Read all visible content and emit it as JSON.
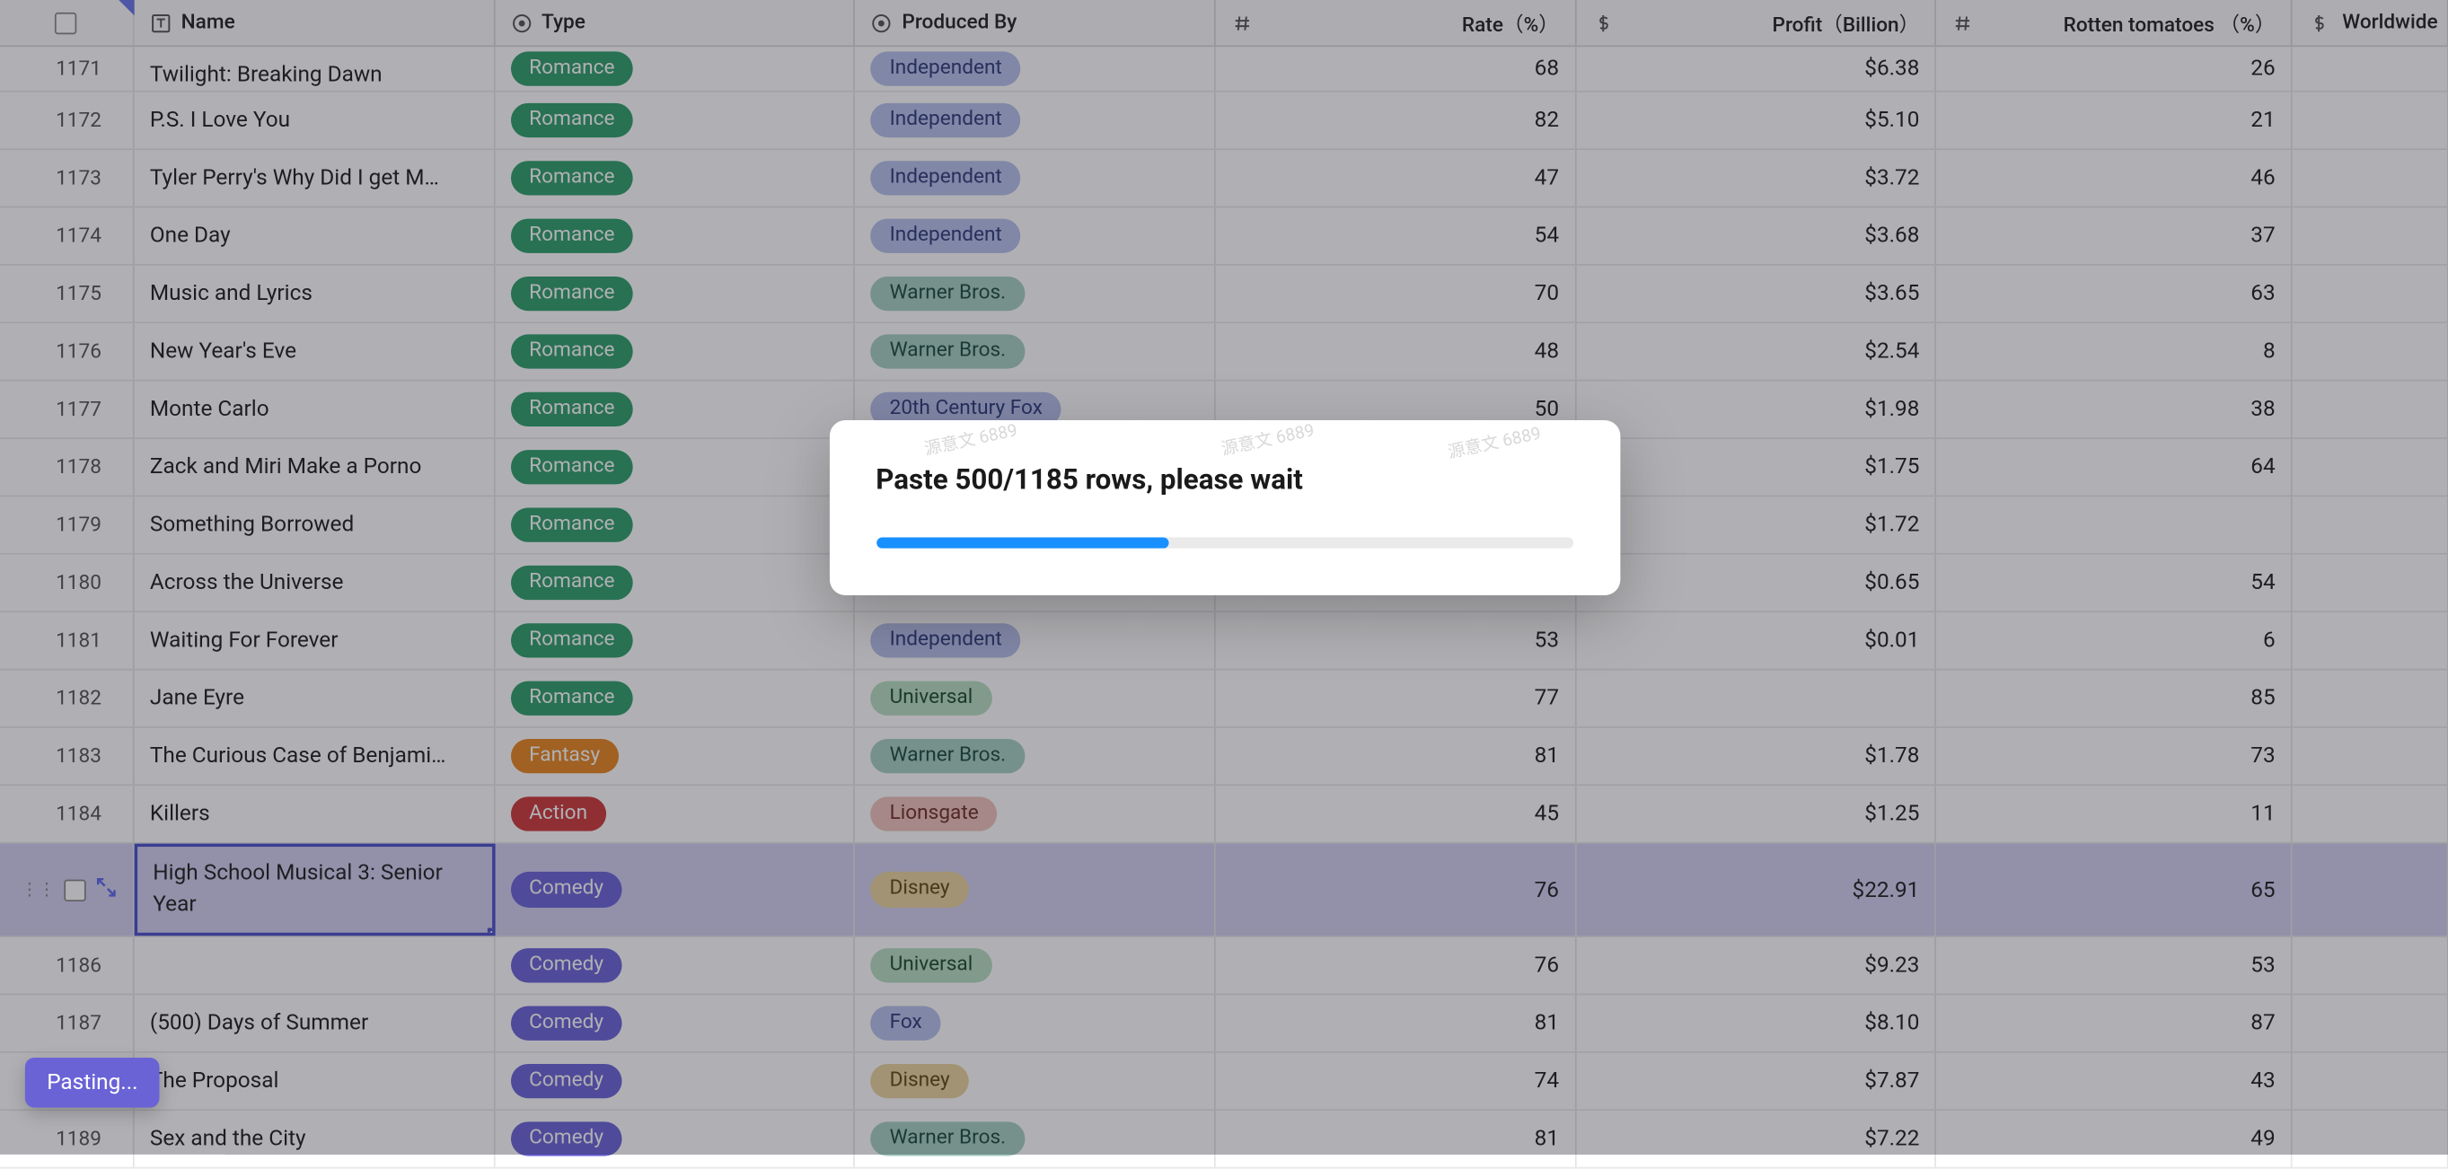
{
  "columns": {
    "name": "Name",
    "type": "Type",
    "produced_by": "Produced By",
    "rate": "Rate（%）",
    "profit": "Profit（Billion）",
    "rotten": "Rotten tomatoes （%）",
    "worldwide": "Worldwide"
  },
  "type_pills": {
    "Romance": "pill-romance",
    "Fantasy": "pill-fantasy",
    "Action": "pill-action",
    "Comedy": "pill-comedy"
  },
  "producer_pills": {
    "Independent": "pill-independent",
    "Warner Bros.": "pill-warner",
    "20th Century Fox": "pill-fox20",
    "Universal": "pill-universal",
    "Disney": "pill-disney",
    "Lionsgate": "pill-lionsgate",
    "Fox": "pill-fox"
  },
  "rows": [
    {
      "n": "1171",
      "name": "Twilight: Breaking Dawn",
      "type": "Romance",
      "prod": "Independent",
      "rate": "68",
      "profit": "$6.38",
      "rotten": "26",
      "short": true
    },
    {
      "n": "1172",
      "name": "P.S. I Love You",
      "type": "Romance",
      "prod": "Independent",
      "rate": "82",
      "profit": "$5.10",
      "rotten": "21"
    },
    {
      "n": "1173",
      "name": "Tyler Perry's Why Did I get M…",
      "type": "Romance",
      "prod": "Independent",
      "rate": "47",
      "profit": "$3.72",
      "rotten": "46"
    },
    {
      "n": "1174",
      "name": "One Day",
      "type": "Romance",
      "prod": "Independent",
      "rate": "54",
      "profit": "$3.68",
      "rotten": "37"
    },
    {
      "n": "1175",
      "name": "Music and Lyrics",
      "type": "Romance",
      "prod": "Warner Bros.",
      "rate": "70",
      "profit": "$3.65",
      "rotten": "63"
    },
    {
      "n": "1176",
      "name": "New Year's Eve",
      "type": "Romance",
      "prod": "Warner Bros.",
      "rate": "48",
      "profit": "$2.54",
      "rotten": "8"
    },
    {
      "n": "1177",
      "name": "Monte Carlo",
      "type": "Romance",
      "prod": "20th Century Fox",
      "rate": "50",
      "profit": "$1.98",
      "rotten": "38"
    },
    {
      "n": "1178",
      "name": "Zack and Miri Make a Porno",
      "type": "Romance",
      "prod": "",
      "rate": "",
      "profit": "$1.75",
      "rotten": "64"
    },
    {
      "n": "1179",
      "name": "Something Borrowed",
      "type": "Romance",
      "prod": "",
      "rate": "",
      "profit": "$1.72",
      "rotten": ""
    },
    {
      "n": "1180",
      "name": "Across the Universe",
      "type": "Romance",
      "prod": "",
      "rate": "",
      "profit": "$0.65",
      "rotten": "54"
    },
    {
      "n": "1181",
      "name": "Waiting For Forever",
      "type": "Romance",
      "prod": "Independent",
      "rate": "53",
      "profit": "$0.01",
      "rotten": "6"
    },
    {
      "n": "1182",
      "name": "Jane Eyre",
      "type": "Romance",
      "prod": "Universal",
      "rate": "77",
      "profit": "",
      "rotten": "85"
    },
    {
      "n": "1183",
      "name": "The Curious Case of Benjami…",
      "type": "Fantasy",
      "prod": "Warner Bros.",
      "rate": "81",
      "profit": "$1.78",
      "rotten": "73"
    },
    {
      "n": "1184",
      "name": "Killers",
      "type": "Action",
      "prod": "Lionsgate",
      "rate": "45",
      "profit": "$1.25",
      "rotten": "11"
    },
    {
      "n": "",
      "name": "High School Musical 3: Senior Year",
      "type": "Comedy",
      "prod": "Disney",
      "rate": "76",
      "profit": "$22.91",
      "rotten": "65",
      "selected": true
    },
    {
      "n": "1186",
      "name": "",
      "type": "Comedy",
      "prod": "Universal",
      "rate": "76",
      "profit": "$9.23",
      "rotten": "53"
    },
    {
      "n": "1187",
      "name": "(500) Days of Summer",
      "type": "Comedy",
      "prod": "Fox",
      "rate": "81",
      "profit": "$8.10",
      "rotten": "87"
    },
    {
      "n": "",
      "name": "The Proposal",
      "type": "Comedy",
      "prod": "Disney",
      "rate": "74",
      "profit": "$7.87",
      "rotten": "43",
      "cutleft": true
    },
    {
      "n": "1189",
      "name": "Sex and the City",
      "type": "Comedy",
      "prod": "Warner Bros.",
      "rate": "81",
      "profit": "$7.22",
      "rotten": "49"
    }
  ],
  "modal": {
    "title": "Paste 500/1185 rows, please wait",
    "progress_percent": 42,
    "watermark": "源意文 6889"
  },
  "toast": {
    "text": "Pasting..."
  }
}
